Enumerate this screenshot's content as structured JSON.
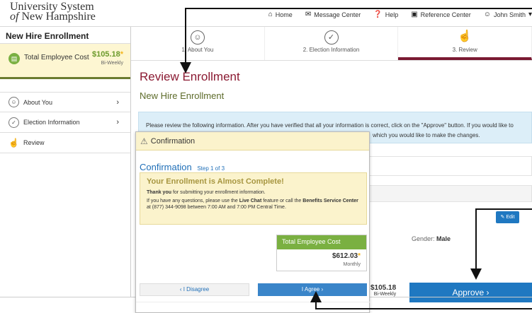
{
  "header": {
    "logo_line1": "University System",
    "logo_of": "of",
    "logo_line2": "New Hampshire",
    "nav": [
      {
        "label": "Home",
        "icon": "home-icon"
      },
      {
        "label": "Message Center",
        "icon": "envelope-icon"
      },
      {
        "label": "Help",
        "icon": "help-icon"
      },
      {
        "label": "Reference Center",
        "icon": "book-icon"
      },
      {
        "label": "John Smith",
        "icon": "user-icon"
      }
    ]
  },
  "sidebar": {
    "title": "New Hire Enrollment",
    "cost_label": "Total Employee Cost",
    "cost_value": "$105.18",
    "cost_period": "Bi-Weekly",
    "items": [
      {
        "label": "About You"
      },
      {
        "label": "Election Information"
      },
      {
        "label": "Review"
      }
    ]
  },
  "steps": [
    {
      "label": "1. About You"
    },
    {
      "label": "2. Election Information"
    },
    {
      "label": "3. Review"
    }
  ],
  "main": {
    "heading": "Review Enrollment",
    "subheading": "New Hire Enrollment",
    "info_text": "Please review the following information. After you have verified that all your information is correct, click on the \"Approve\" button. If you would like to",
    "info_text_2": "which you would like to make the changes.",
    "gender_label": "Gender:",
    "gender_value": "Male",
    "edit_label": "Edit",
    "footer_cost": "$105.18",
    "footer_period": "Bi-Weekly",
    "approve_label": "Approve"
  },
  "modal": {
    "title": "Confirmation",
    "heading": "Confirmation",
    "step": "Step 1 of 3",
    "box_title": "Your Enrollment is Almost Complete!",
    "thank_bold": "Thank you",
    "thank_rest": "for submitting your enrollment information.",
    "q_1": "If you have any questions, please use the",
    "q_live_chat": "Live Chat",
    "q_2": "feature or call the",
    "q_bsc": "Benefits Service Center",
    "q_3": "at (877) 344-9098 between 7:00 AM and 7:00 PM Central Time.",
    "total_label": "Total Employee Cost",
    "total_value": "$612.03",
    "total_period": "Monthly",
    "disagree_label": "I Disagree",
    "agree_label": "I Agree"
  },
  "colors": {
    "brand_maroon": "#8b1a32",
    "olive": "#5d6b2a",
    "blue": "#1f78c1",
    "green": "#7ab041"
  }
}
